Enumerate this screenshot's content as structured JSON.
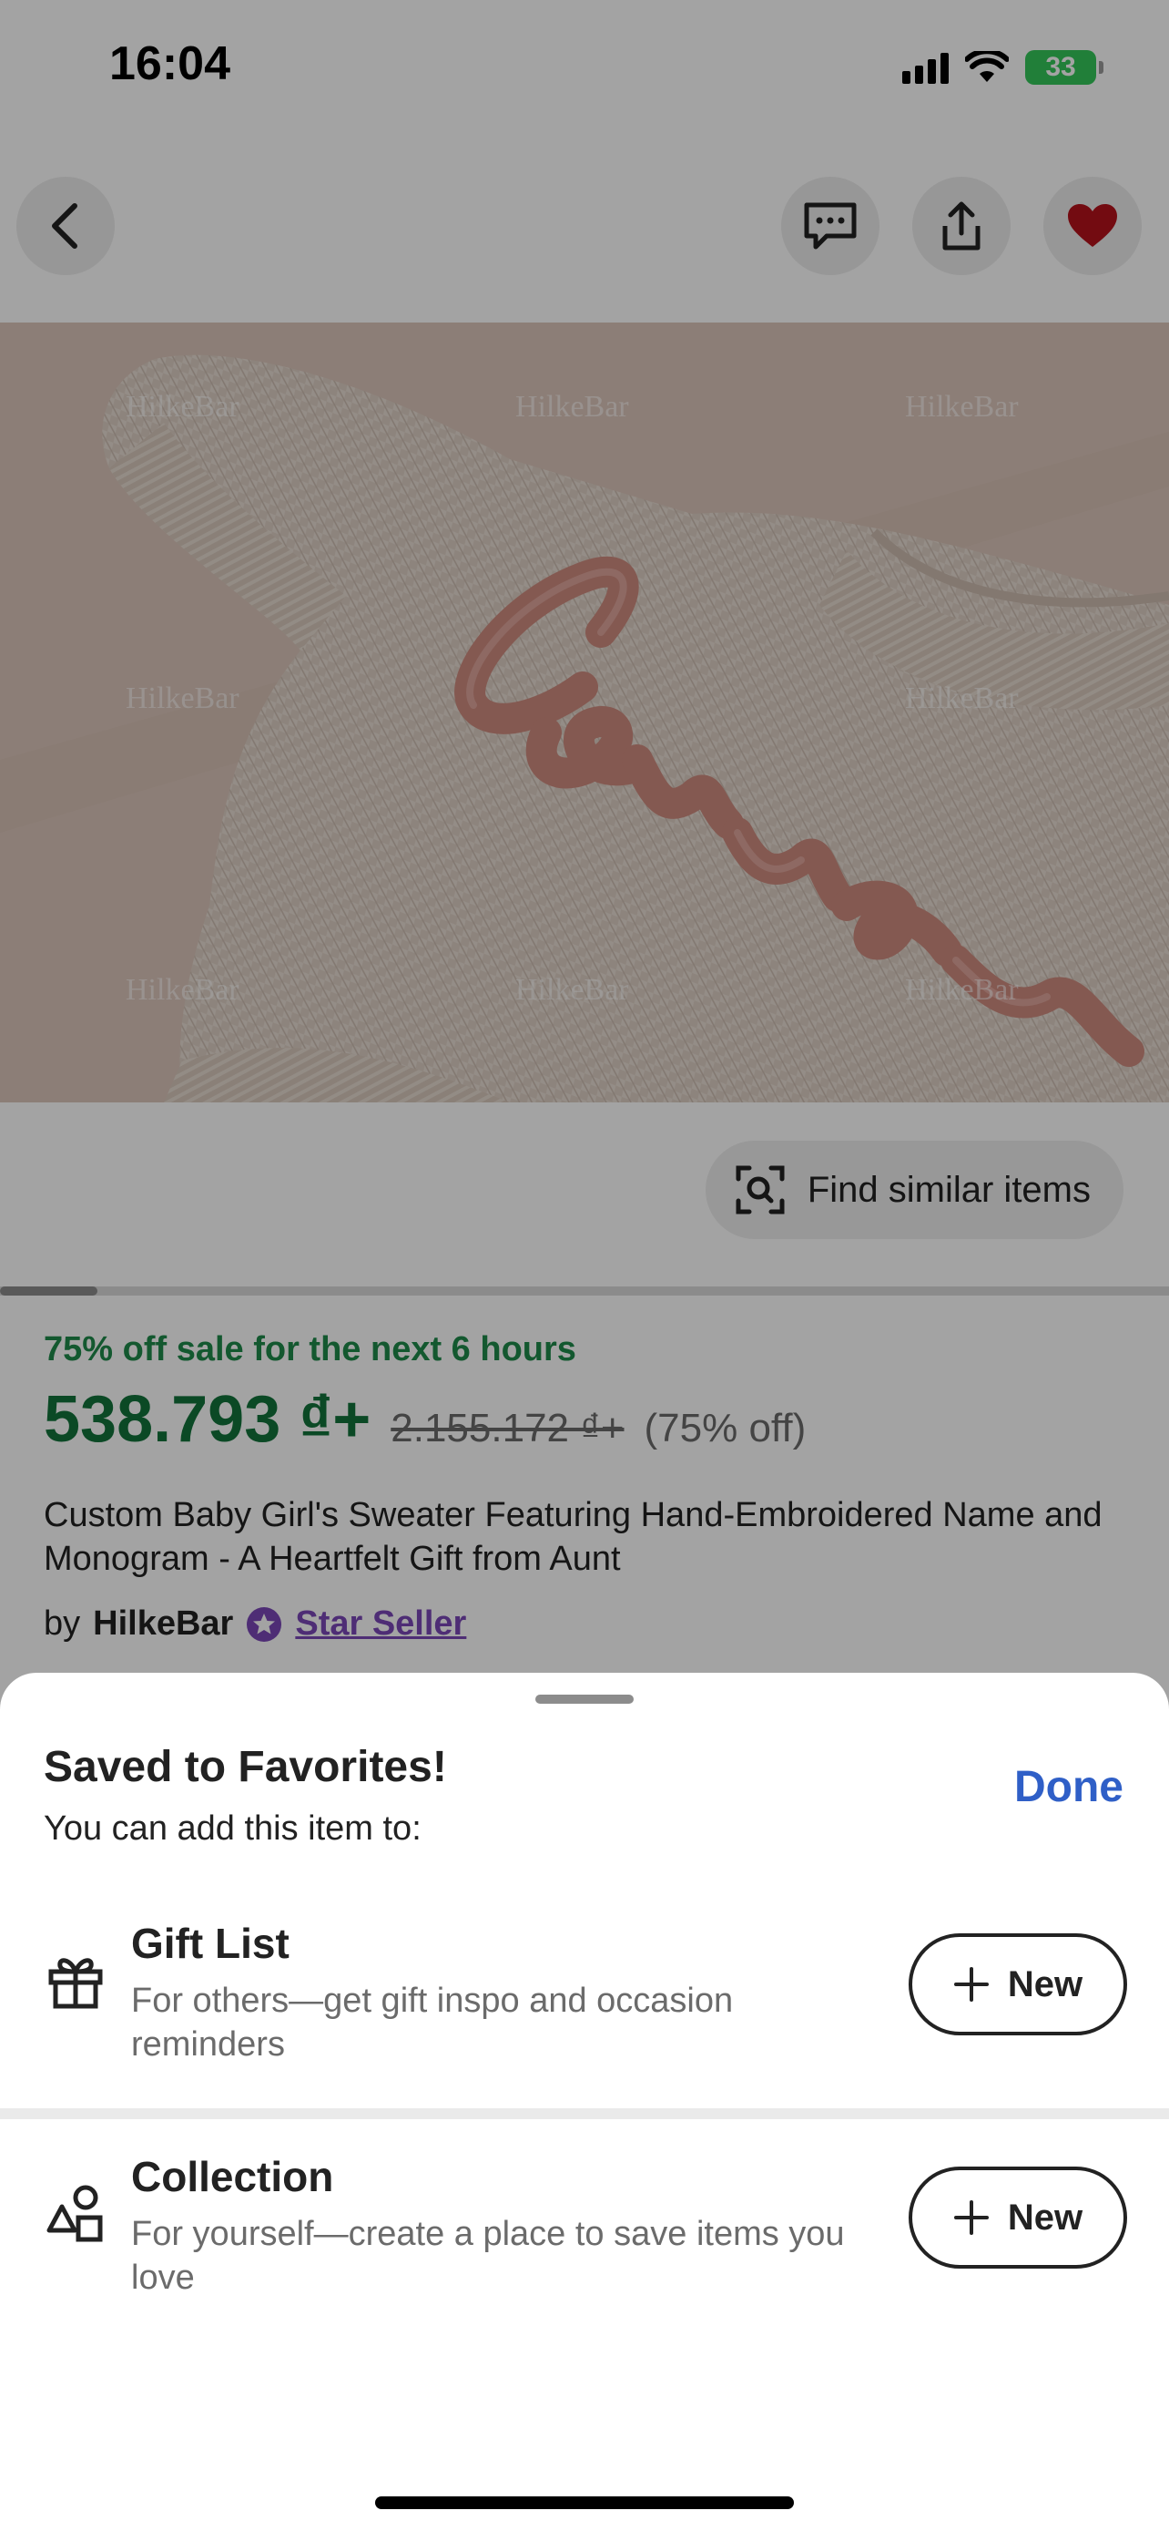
{
  "status_bar": {
    "time": "16:04",
    "battery": "33"
  },
  "nav": {
    "back_icon": "chevron-left-icon",
    "message_icon": "message-icon",
    "share_icon": "share-icon",
    "favorite_icon": "heart-icon",
    "favorite_color": "#b5121b"
  },
  "photo": {
    "watermark": "HilkeBar",
    "embroidered_name": "Conner"
  },
  "find_similar": {
    "label": "Find similar items",
    "icon": "visual-search-icon"
  },
  "gallery": {
    "position": 1,
    "count": 12
  },
  "listing": {
    "sale_banner": "75% off sale for the next 6 hours",
    "price": "538.793 ₫+",
    "original_price": "2.155.172 ₫+",
    "discount": "(75% off)",
    "title": "Custom Baby Girl's Sweater Featuring Hand-Embroidered Name and Monogram - A Heartfelt Gift from Aunt",
    "seller_prefix": "by",
    "seller_name": "HilkeBar",
    "star_seller": "Star Seller",
    "star_icon": "star-badge-icon"
  },
  "sheet": {
    "title": "Saved to Favorites!",
    "subtitle": "You can add this item to:",
    "done_label": "Done",
    "options": [
      {
        "title": "Gift List",
        "description": "For others—get gift inspo and occasion reminders",
        "icon": "gift-icon",
        "button_label": "New"
      },
      {
        "title": "Collection",
        "description": "For yourself—create a place to save items you love",
        "icon": "shapes-icon",
        "button_label": "New"
      }
    ]
  },
  "colors": {
    "sale_green": "#12733a",
    "link_blue": "#2f5fc7",
    "star_purple": "#7a47b8"
  }
}
